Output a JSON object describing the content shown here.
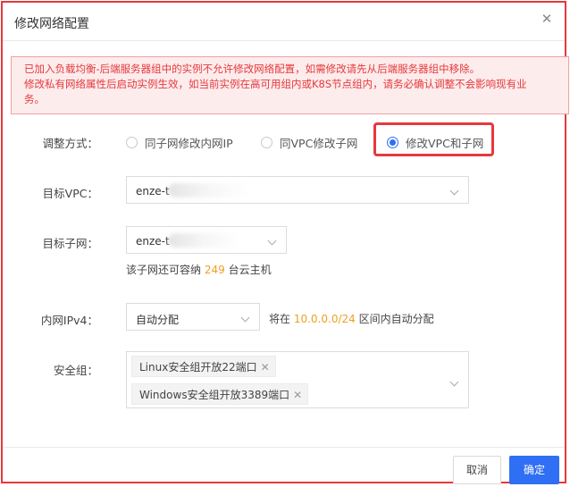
{
  "dialog": {
    "title": "修改网络配置",
    "close_symbol": "✕"
  },
  "alert": {
    "line1": "已加入负载均衡-后端服务器组中的实例不允许修改网络配置，如需修改请先从后端服务器组中移除。",
    "line2": "修改私有网络属性后启动实例生效，如当前实例在高可用组内或K8S节点组内，请务必确认调整不会影响现有业",
    "line3": "务。"
  },
  "form": {
    "adjust_label": "调整方式：",
    "options": [
      {
        "label": "同子网修改内网IP",
        "selected": false
      },
      {
        "label": "同VPC修改子网",
        "selected": false
      },
      {
        "label": "修改VPC和子网",
        "selected": true
      }
    ],
    "vpc_label": "目标VPC：",
    "vpc_value": "enze-t",
    "subnet_label": "目标子网：",
    "subnet_value": "enze-t",
    "subnet_hint_pre": "该子网还可容纳",
    "subnet_hint_num": "249",
    "subnet_hint_post": "台云主机",
    "ipv4_label": "内网IPv4：",
    "ipv4_value": "自动分配",
    "ipv4_hint_pre": "将在",
    "ipv4_hint_range": "10.0.0.0/24",
    "ipv4_hint_post": "区间内自动分配",
    "sg_label": "安全组：",
    "security_groups": [
      {
        "label": "Linux安全组开放22端口"
      },
      {
        "label": "Windows安全组开放3389端口"
      }
    ],
    "tag_close": "✕"
  },
  "footer": {
    "cancel": "取消",
    "ok": "确定"
  },
  "colors": {
    "accent": "#2f6ff3",
    "warning": "#e5393d",
    "highlight_number": "#f0a020"
  },
  "icons": [
    "close-icon",
    "chevron-down-icon",
    "tag-close-icon",
    "radio-icon"
  ]
}
